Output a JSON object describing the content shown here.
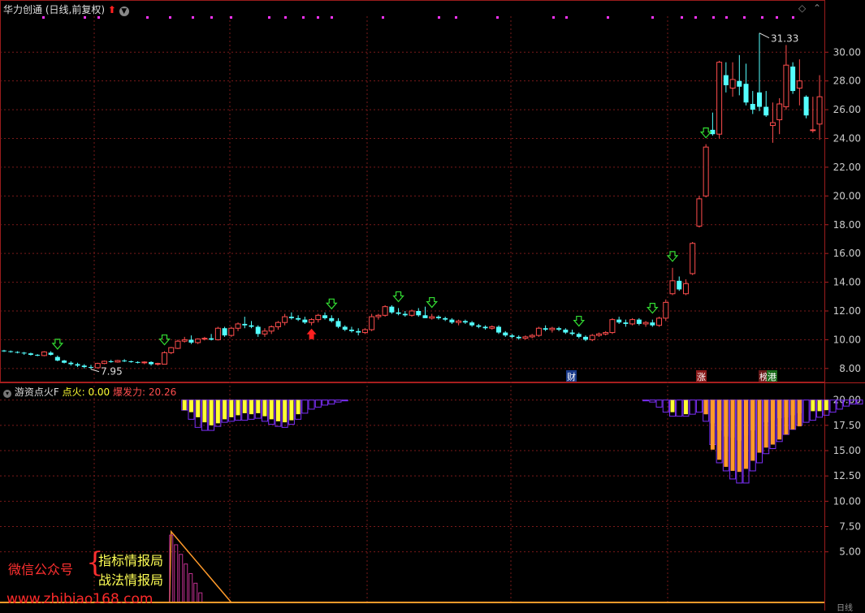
{
  "header": {
    "stock_name": "华力创通",
    "mode": "(日线,前复权)"
  },
  "indicator": {
    "name": "游资点火F",
    "ignite_label": "点火:",
    "ignite_value": "0.00",
    "burst_label": "爆发力:",
    "burst_value": "20.26"
  },
  "watermark": {
    "line_left": "微信公众号",
    "line_right_1": "指标情报局",
    "line_right_2": "战法情报局",
    "url": "www.zhibiao168.com"
  },
  "bottom": {
    "right_label": "日线"
  },
  "colors": {
    "up": "#ff4d4d",
    "down": "#54ffff",
    "grid": "#7a1a1a",
    "axis_text": "#cccccc",
    "yellow": "#ffff33",
    "orange": "#ff9a2a",
    "purple": "#7b2ff7",
    "magenta": "#ff33ff",
    "green_arrow": "#33dd33",
    "red_arrow": "#ff2020"
  },
  "chart_data": [
    {
      "type": "candlestick",
      "y_ticks": [
        8.0,
        10.0,
        12.0,
        14.0,
        16.0,
        18.0,
        20.0,
        22.0,
        24.0,
        26.0,
        28.0,
        30.0
      ],
      "ylim": [
        7.2,
        32.5
      ],
      "high_label": "31.33",
      "low_label": "7.95",
      "event_tags": [
        "财",
        "涨",
        "榜",
        "港"
      ],
      "candles": [
        [
          9.25,
          9.3,
          9.15,
          9.2
        ],
        [
          9.2,
          9.25,
          9.1,
          9.15
        ],
        [
          9.15,
          9.2,
          9.05,
          9.1
        ],
        [
          9.1,
          9.15,
          8.95,
          9.05
        ],
        [
          9.05,
          9.1,
          8.9,
          8.95
        ],
        [
          8.95,
          9.0,
          8.85,
          8.9
        ],
        [
          8.9,
          9.2,
          8.85,
          9.15
        ],
        [
          9.1,
          9.2,
          8.9,
          8.95
        ],
        [
          8.8,
          8.9,
          8.5,
          8.55
        ],
        [
          8.55,
          8.6,
          8.35,
          8.4
        ],
        [
          8.4,
          8.5,
          8.2,
          8.3
        ],
        [
          8.3,
          8.4,
          8.1,
          8.2
        ],
        [
          8.2,
          8.3,
          8.0,
          8.1
        ],
        [
          8.1,
          8.25,
          7.95,
          8.05
        ],
        [
          8.05,
          8.4,
          8.0,
          8.35
        ],
        [
          8.35,
          8.55,
          8.3,
          8.5
        ],
        [
          8.5,
          8.6,
          8.4,
          8.45
        ],
        [
          8.45,
          8.6,
          8.4,
          8.55
        ],
        [
          8.55,
          8.65,
          8.45,
          8.5
        ],
        [
          8.5,
          8.55,
          8.4,
          8.45
        ],
        [
          8.45,
          8.5,
          8.35,
          8.4
        ],
        [
          8.4,
          8.5,
          8.3,
          8.45
        ],
        [
          8.45,
          8.5,
          8.2,
          8.3
        ],
        [
          8.3,
          8.4,
          8.2,
          8.35
        ],
        [
          8.3,
          9.2,
          8.3,
          9.1
        ],
        [
          9.1,
          9.5,
          9.0,
          9.45
        ],
        [
          9.4,
          10.0,
          9.35,
          9.9
        ],
        [
          9.9,
          10.2,
          9.8,
          10.0
        ],
        [
          10.0,
          10.3,
          9.7,
          9.8
        ],
        [
          9.8,
          10.1,
          9.7,
          10.05
        ],
        [
          10.05,
          10.2,
          9.95,
          10.1
        ],
        [
          10.1,
          10.4,
          9.95,
          10.0
        ],
        [
          10.0,
          10.9,
          9.95,
          10.8
        ],
        [
          10.8,
          10.9,
          10.2,
          10.3
        ],
        [
          10.3,
          10.9,
          10.2,
          10.8
        ],
        [
          10.8,
          11.2,
          10.6,
          11.1
        ],
        [
          11.1,
          11.6,
          10.8,
          11.0
        ],
        [
          11.0,
          11.3,
          10.8,
          10.9
        ],
        [
          10.9,
          11.0,
          10.2,
          10.4
        ],
        [
          10.4,
          10.8,
          10.2,
          10.6
        ],
        [
          10.6,
          11.0,
          10.4,
          10.9
        ],
        [
          10.9,
          11.3,
          10.7,
          11.2
        ],
        [
          11.2,
          11.8,
          11.0,
          11.6
        ],
        [
          11.6,
          11.9,
          11.4,
          11.5
        ],
        [
          11.5,
          11.7,
          11.3,
          11.4
        ],
        [
          11.4,
          11.6,
          11.1,
          11.2
        ],
        [
          11.2,
          11.5,
          11.0,
          11.4
        ],
        [
          11.4,
          11.8,
          11.2,
          11.7
        ],
        [
          11.7,
          11.9,
          11.4,
          11.5
        ],
        [
          11.5,
          11.7,
          11.2,
          11.3
        ],
        [
          11.3,
          11.5,
          10.8,
          10.9
        ],
        [
          10.9,
          11.0,
          10.6,
          10.7
        ],
        [
          10.7,
          10.9,
          10.5,
          10.6
        ],
        [
          10.6,
          10.8,
          10.3,
          10.5
        ],
        [
          10.5,
          10.8,
          10.4,
          10.7
        ],
        [
          10.7,
          11.8,
          10.6,
          11.6
        ],
        [
          11.6,
          11.8,
          11.4,
          11.7
        ],
        [
          11.7,
          12.4,
          11.6,
          12.3
        ],
        [
          12.3,
          12.4,
          11.8,
          11.9
        ],
        [
          11.9,
          12.2,
          11.7,
          11.8
        ],
        [
          11.8,
          12.0,
          11.6,
          11.7
        ],
        [
          11.7,
          12.1,
          11.6,
          12.0
        ],
        [
          12.0,
          12.2,
          11.6,
          11.7
        ],
        [
          11.7,
          12.3,
          11.6,
          11.5
        ],
        [
          11.5,
          11.8,
          11.4,
          11.6
        ],
        [
          11.6,
          11.7,
          11.4,
          11.5
        ],
        [
          11.5,
          11.6,
          11.3,
          11.4
        ],
        [
          11.4,
          11.5,
          11.1,
          11.2
        ],
        [
          11.2,
          11.4,
          11.0,
          11.3
        ],
        [
          11.3,
          11.4,
          11.1,
          11.2
        ],
        [
          11.2,
          11.3,
          10.9,
          11.0
        ],
        [
          11.0,
          11.1,
          10.8,
          10.9
        ],
        [
          10.9,
          11.0,
          10.7,
          10.8
        ],
        [
          10.8,
          11.0,
          10.7,
          10.9
        ],
        [
          10.9,
          11.0,
          10.4,
          10.5
        ],
        [
          10.5,
          10.6,
          10.2,
          10.3
        ],
        [
          10.3,
          10.4,
          10.1,
          10.2
        ],
        [
          10.2,
          10.3,
          10.0,
          10.1
        ],
        [
          10.1,
          10.3,
          10.0,
          10.2
        ],
        [
          10.2,
          10.4,
          10.1,
          10.3
        ],
        [
          10.3,
          10.9,
          10.2,
          10.8
        ],
        [
          10.8,
          11.0,
          10.6,
          10.7
        ],
        [
          10.7,
          10.9,
          10.5,
          10.8
        ],
        [
          10.8,
          10.9,
          10.6,
          10.7
        ],
        [
          10.7,
          10.8,
          10.4,
          10.5
        ],
        [
          10.5,
          10.7,
          10.3,
          10.4
        ],
        [
          10.4,
          10.5,
          10.1,
          10.2
        ],
        [
          10.2,
          10.3,
          9.9,
          10.0
        ],
        [
          10.0,
          10.4,
          9.9,
          10.3
        ],
        [
          10.3,
          10.5,
          10.2,
          10.4
        ],
        [
          10.4,
          10.6,
          10.3,
          10.5
        ],
        [
          10.5,
          11.5,
          10.4,
          11.4
        ],
        [
          11.4,
          11.6,
          11.1,
          11.2
        ],
        [
          11.2,
          11.4,
          10.9,
          11.1
        ],
        [
          11.1,
          11.5,
          11.0,
          11.4
        ],
        [
          11.4,
          11.5,
          11.0,
          11.1
        ],
        [
          11.1,
          11.3,
          10.9,
          11.2
        ],
        [
          11.2,
          11.4,
          10.9,
          11.0
        ],
        [
          11.0,
          11.6,
          10.9,
          11.5
        ],
        [
          11.5,
          12.8,
          11.3,
          12.6
        ],
        [
          13.2,
          15.0,
          13.1,
          14.1
        ],
        [
          14.1,
          14.4,
          13.4,
          13.5
        ],
        [
          13.2,
          14.2,
          13.1,
          13.9
        ],
        [
          14.6,
          16.8,
          14.5,
          16.7
        ],
        [
          17.9,
          20.0,
          17.8,
          19.8
        ],
        [
          20.0,
          23.6,
          19.9,
          23.4
        ],
        [
          24.6,
          25.8,
          24.2,
          24.3
        ],
        [
          24.3,
          29.4,
          24.0,
          29.3
        ],
        [
          28.4,
          29.3,
          27.2,
          27.7
        ],
        [
          27.5,
          29.3,
          26.9,
          28.1
        ],
        [
          28.0,
          29.8,
          27.0,
          27.6
        ],
        [
          27.8,
          29.2,
          26.3,
          26.5
        ],
        [
          26.4,
          27.3,
          25.7,
          26.0
        ],
        [
          27.2,
          31.33,
          25.9,
          26.2
        ],
        [
          26.2,
          27.3,
          25.5,
          25.6
        ],
        [
          24.9,
          26.5,
          23.7,
          25.1
        ],
        [
          25.3,
          26.8,
          24.3,
          26.4
        ],
        [
          26.2,
          30.5,
          26.0,
          29.1
        ],
        [
          29.0,
          29.3,
          27.1,
          27.3
        ],
        [
          27.5,
          29.5,
          26.3,
          28.0
        ],
        [
          26.9,
          27.0,
          25.4,
          25.6
        ],
        [
          24.6,
          26.9,
          24.4,
          24.6
        ],
        [
          25.0,
          28.4,
          23.9,
          26.9
        ]
      ],
      "up_signal_index": [
        46
      ],
      "down_signal_indices": [
        8,
        24,
        49,
        59,
        64,
        86,
        97,
        100,
        105
      ]
    },
    {
      "type": "bar",
      "name": "游资点火F",
      "y_ticks": [
        5.0,
        7.5,
        10.0,
        12.5,
        15.0,
        17.5,
        20.0
      ],
      "ylim": [
        0,
        21.5
      ],
      "baseline": 20,
      "segments": [
        {
          "start": 27,
          "purple": [
            19.0,
            18.1,
            17.3,
            17.0,
            17.0,
            17.4,
            17.8,
            17.9,
            18.0,
            18.0,
            18.1,
            18.2,
            17.9,
            17.6,
            17.4,
            17.3,
            17.6,
            18.1,
            18.7,
            19.1,
            19.3,
            19.5,
            19.6,
            19.8,
            20.0
          ],
          "yellow": [
            19.0,
            18.8,
            18.3,
            17.8,
            17.5,
            17.7,
            18.1,
            18.3,
            18.5,
            18.7,
            18.6,
            18.7,
            18.4,
            18.1,
            17.9,
            17.8,
            18.0,
            18.6
          ]
        },
        {
          "start": 96,
          "purple": [
            20.0,
            19.8,
            19.3,
            18.8,
            18.4,
            18.4,
            18.4,
            18.6,
            18.8,
            17.9,
            15.6,
            13.8,
            13.0,
            12.2,
            11.8,
            11.8,
            13.0,
            13.8,
            14.7,
            15.2,
            15.9,
            16.6,
            17.1,
            17.5,
            17.8,
            18.0,
            18.3,
            18.5,
            18.8,
            19.1,
            19.4,
            19.6,
            19.6
          ],
          "yellow": [
            null,
            null,
            null,
            null,
            18.8,
            null,
            18.6,
            null,
            null,
            18.6,
            17.7,
            17.0,
            16.4,
            16.3,
            16.0,
            16.5,
            17.0,
            17.4,
            17.8,
            18.0,
            18.2,
            18.3,
            18.5,
            18.7,
            null,
            18.9,
            18.9,
            19.0
          ],
          "orange": [
            null,
            null,
            null,
            null,
            null,
            null,
            null,
            null,
            null,
            18.6,
            15.1,
            14.1,
            13.4,
            13.0,
            12.9,
            13.2,
            14.0,
            14.8,
            15.3,
            15.6,
            16.1,
            16.6,
            17.1,
            17.4
          ]
        }
      ],
      "spike": {
        "start_index": 25,
        "peak_value": 7.0,
        "end_index": 34
      }
    }
  ]
}
